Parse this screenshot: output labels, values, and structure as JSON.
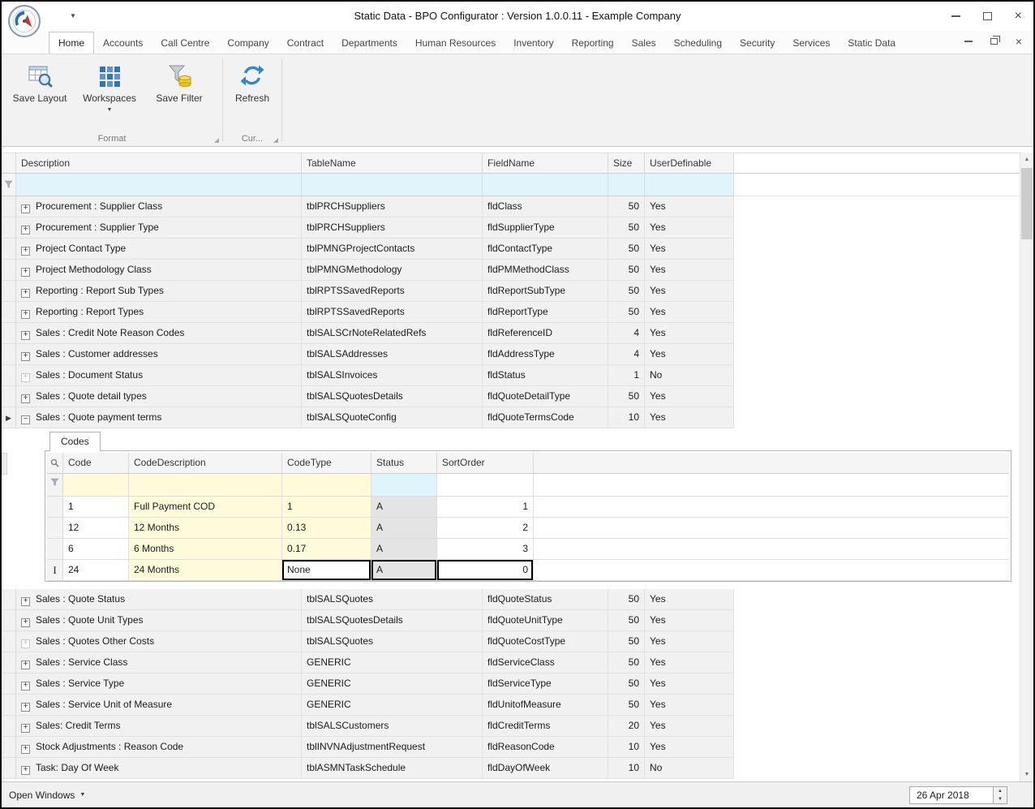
{
  "window": {
    "title": "Static Data - BPO Configurator : Version 1.0.0.11 - Example Company"
  },
  "icons": {
    "qat_dropdown": "▼",
    "workspaces_dropdown": "▼",
    "open_windows_caret": "▼",
    "scroll_up": "▲",
    "scroll_down": "▼",
    "spin_up": "▲",
    "spin_down": "▼",
    "close": "×"
  },
  "colors": {
    "filter_cyan": "#dff4fb",
    "cell_yellow": "#fffbda",
    "status_gray": "#e4e4e4",
    "edit_border": "#000000",
    "accent_blue": "#2e86d4"
  },
  "ribbon": {
    "tabs": [
      {
        "label": "Home",
        "state": "sel"
      },
      {
        "label": "Accounts"
      },
      {
        "label": "Call Centre"
      },
      {
        "label": "Company"
      },
      {
        "label": "Contract"
      },
      {
        "label": "Departments"
      },
      {
        "label": "Human Resources"
      },
      {
        "label": "Inventory"
      },
      {
        "label": "Reporting"
      },
      {
        "label": "Sales"
      },
      {
        "label": "Scheduling"
      },
      {
        "label": "Security"
      },
      {
        "label": "Services"
      },
      {
        "label": "Static Data"
      }
    ],
    "buttons": {
      "save_layout": "Save Layout",
      "workspaces": "Workspaces",
      "save_filter": "Save Filter",
      "refresh": "Refresh"
    },
    "groups": {
      "format": "Format",
      "current": "Cur..."
    }
  },
  "grid": {
    "columns": [
      "Description",
      "TableName",
      "FieldName",
      "Size",
      "UserDefinable"
    ],
    "rows_before": [
      {
        "expand": "plus",
        "description": "Procurement : Supplier Class",
        "table": "tblPRCHSuppliers",
        "field": "fldClass",
        "size": "50",
        "user_definable": "Yes"
      },
      {
        "expand": "plus",
        "description": "Procurement : Supplier Type",
        "table": "tblPRCHSuppliers",
        "field": "fldSupplierType",
        "size": "50",
        "user_definable": "Yes"
      },
      {
        "expand": "plus",
        "description": "Project Contact Type",
        "table": "tblPMNGProjectContacts",
        "field": "fldContactType",
        "size": "50",
        "user_definable": "Yes"
      },
      {
        "expand": "plus",
        "description": "Project Methodology Class",
        "table": "tblPMNGMethodology",
        "field": "fldPMMethodClass",
        "size": "50",
        "user_definable": "Yes"
      },
      {
        "expand": "plus",
        "description": "Reporting : Report Sub Types",
        "table": "tblRPTSSavedReports",
        "field": "fldReportSubType",
        "size": "50",
        "user_definable": "Yes"
      },
      {
        "expand": "plus",
        "description": "Reporting : Report Types",
        "table": "tblRPTSSavedReports",
        "field": "fldReportType",
        "size": "50",
        "user_definable": "Yes"
      },
      {
        "expand": "plus",
        "description": "Sales : Credit Note Reason Codes",
        "table": "tblSALSCrNoteRelatedRefs",
        "field": "fldReferenceID",
        "size": "4",
        "user_definable": "Yes"
      },
      {
        "expand": "plus",
        "description": "Sales : Customer addresses",
        "table": "tblSALSAddresses",
        "field": "fldAddressType",
        "size": "4",
        "user_definable": "Yes"
      },
      {
        "expand": "plusdim",
        "description": "Sales : Document Status",
        "table": "tblSALSInvoices",
        "field": "fldStatus",
        "size": "1",
        "user_definable": "No"
      },
      {
        "expand": "plus",
        "description": "Sales : Quote detail types",
        "table": "tblSALSQuotesDetails",
        "field": "fldQuoteDetailType",
        "size": "50",
        "user_definable": "Yes"
      },
      {
        "expand": "minus",
        "marker": "▶",
        "description": "Sales : Quote payment terms",
        "table": "tblSALSQuoteConfig",
        "field": "fldQuoteTermsCode",
        "size": "10",
        "user_definable": "Yes"
      }
    ],
    "rows_after": [
      {
        "expand": "plus",
        "description": "Sales : Quote Status",
        "table": "tblSALSQuotes",
        "field": "fldQuoteStatus",
        "size": "50",
        "user_definable": "Yes"
      },
      {
        "expand": "plus",
        "description": "Sales : Quote Unit Types",
        "table": "tblSALSQuotesDetails",
        "field": "fldQuoteUnitType",
        "size": "50",
        "user_definable": "Yes"
      },
      {
        "expand": "plusdim",
        "description": "Sales : Quotes Other Costs",
        "table": "tblSALSQuotes",
        "field": "fldQuoteCostType",
        "size": "50",
        "user_definable": "Yes"
      },
      {
        "expand": "plus",
        "description": "Sales : Service Class",
        "table": "GENERIC",
        "field": "fldServiceClass",
        "size": "50",
        "user_definable": "Yes"
      },
      {
        "expand": "plus",
        "description": "Sales : Service Type",
        "table": "GENERIC",
        "field": "fldServiceType",
        "size": "50",
        "user_definable": "Yes"
      },
      {
        "expand": "plus",
        "description": "Sales : Service Unit of Measure",
        "table": "GENERIC",
        "field": "fldUnitofMeasure",
        "size": "50",
        "user_definable": "Yes"
      },
      {
        "expand": "plus",
        "description": "Sales: Credit Terms",
        "table": "tblSALSCustomers",
        "field": "fldCreditTerms",
        "size": "20",
        "user_definable": "Yes"
      },
      {
        "expand": "plus",
        "description": "Stock Adjustments : Reason Code",
        "table": "tblINVNAdjustmentRequest",
        "field": "fldReasonCode",
        "size": "10",
        "user_definable": "Yes"
      },
      {
        "expand": "plus",
        "description": "Task: Day Of Week",
        "table": "tblASMNTaskSchedule",
        "field": "fldDayOfWeek",
        "size": "10",
        "user_definable": "No"
      }
    ]
  },
  "detail": {
    "tab_label": "Codes",
    "columns": [
      "Code",
      "CodeDescription",
      "CodeType",
      "Status",
      "SortOrder"
    ],
    "rows": [
      {
        "code": "1",
        "description": "Full Payment COD",
        "type": "1",
        "status": "A",
        "sort": "1"
      },
      {
        "code": "12",
        "description": "12 Months",
        "type": "0.13",
        "status": "A",
        "sort": "2"
      },
      {
        "code": "6",
        "description": "6 Months",
        "type": "0.17",
        "status": "A",
        "sort": "3"
      },
      {
        "code": "24",
        "marker": "I",
        "state": "edit",
        "description": "24 Months",
        "type": "None",
        "status": "A",
        "sort": "0"
      }
    ]
  },
  "statusbar": {
    "open_windows_label": "Open Windows",
    "date_value": "26 Apr 2018"
  }
}
